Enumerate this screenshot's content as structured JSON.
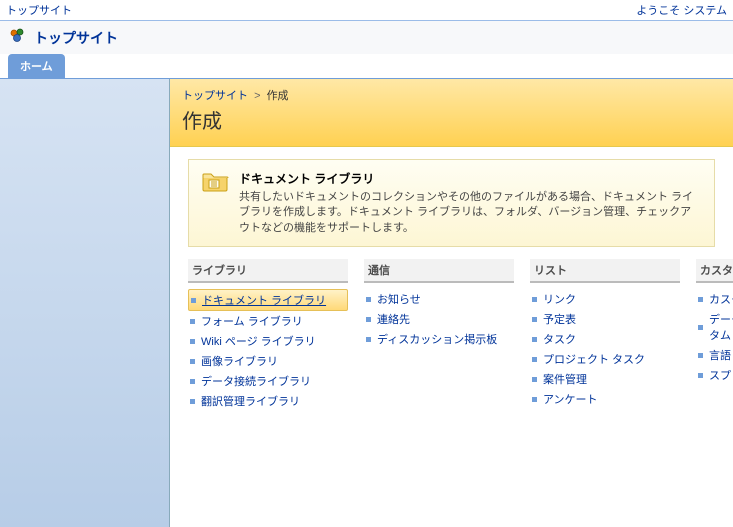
{
  "topbar": {
    "left": "トップサイト",
    "right": "ようこそ システム"
  },
  "site": {
    "title": "トップサイト"
  },
  "tabs": {
    "home": "ホーム"
  },
  "breadcrumb": {
    "site": "トップサイト",
    "sep": ">",
    "current": "作成"
  },
  "page": {
    "title": "作成"
  },
  "infobox": {
    "heading": "ドキュメント ライブラリ",
    "body": "共有したいドキュメントのコレクションやその他のファイルがある場合、ドキュメント ライブラリを作成します。ドキュメント ライブラリは、フォルダ、バージョン管理、チェックアウトなどの機能をサポートします。"
  },
  "categories": {
    "library": {
      "head": "ライブラリ",
      "items": [
        "ドキュメント ライブラリ",
        "フォーム ライブラリ",
        "Wiki ページ ライブラリ",
        "画像ライブラリ",
        "データ接続ライブラリ",
        "翻訳管理ライブラリ"
      ]
    },
    "comm": {
      "head": "通信",
      "items": [
        "お知らせ",
        "連絡先",
        "ディスカッション掲示板"
      ]
    },
    "list": {
      "head": "リスト",
      "items": [
        "リンク",
        "予定表",
        "タスク",
        "プロジェクト タスク",
        "案件管理",
        "アンケート"
      ]
    },
    "custom": {
      "head": "カスタム リ",
      "items": [
        "カスタム",
        "データシ",
        "言語と翻",
        "スプレッド"
      ]
    },
    "custom_extra": "タム リス"
  }
}
